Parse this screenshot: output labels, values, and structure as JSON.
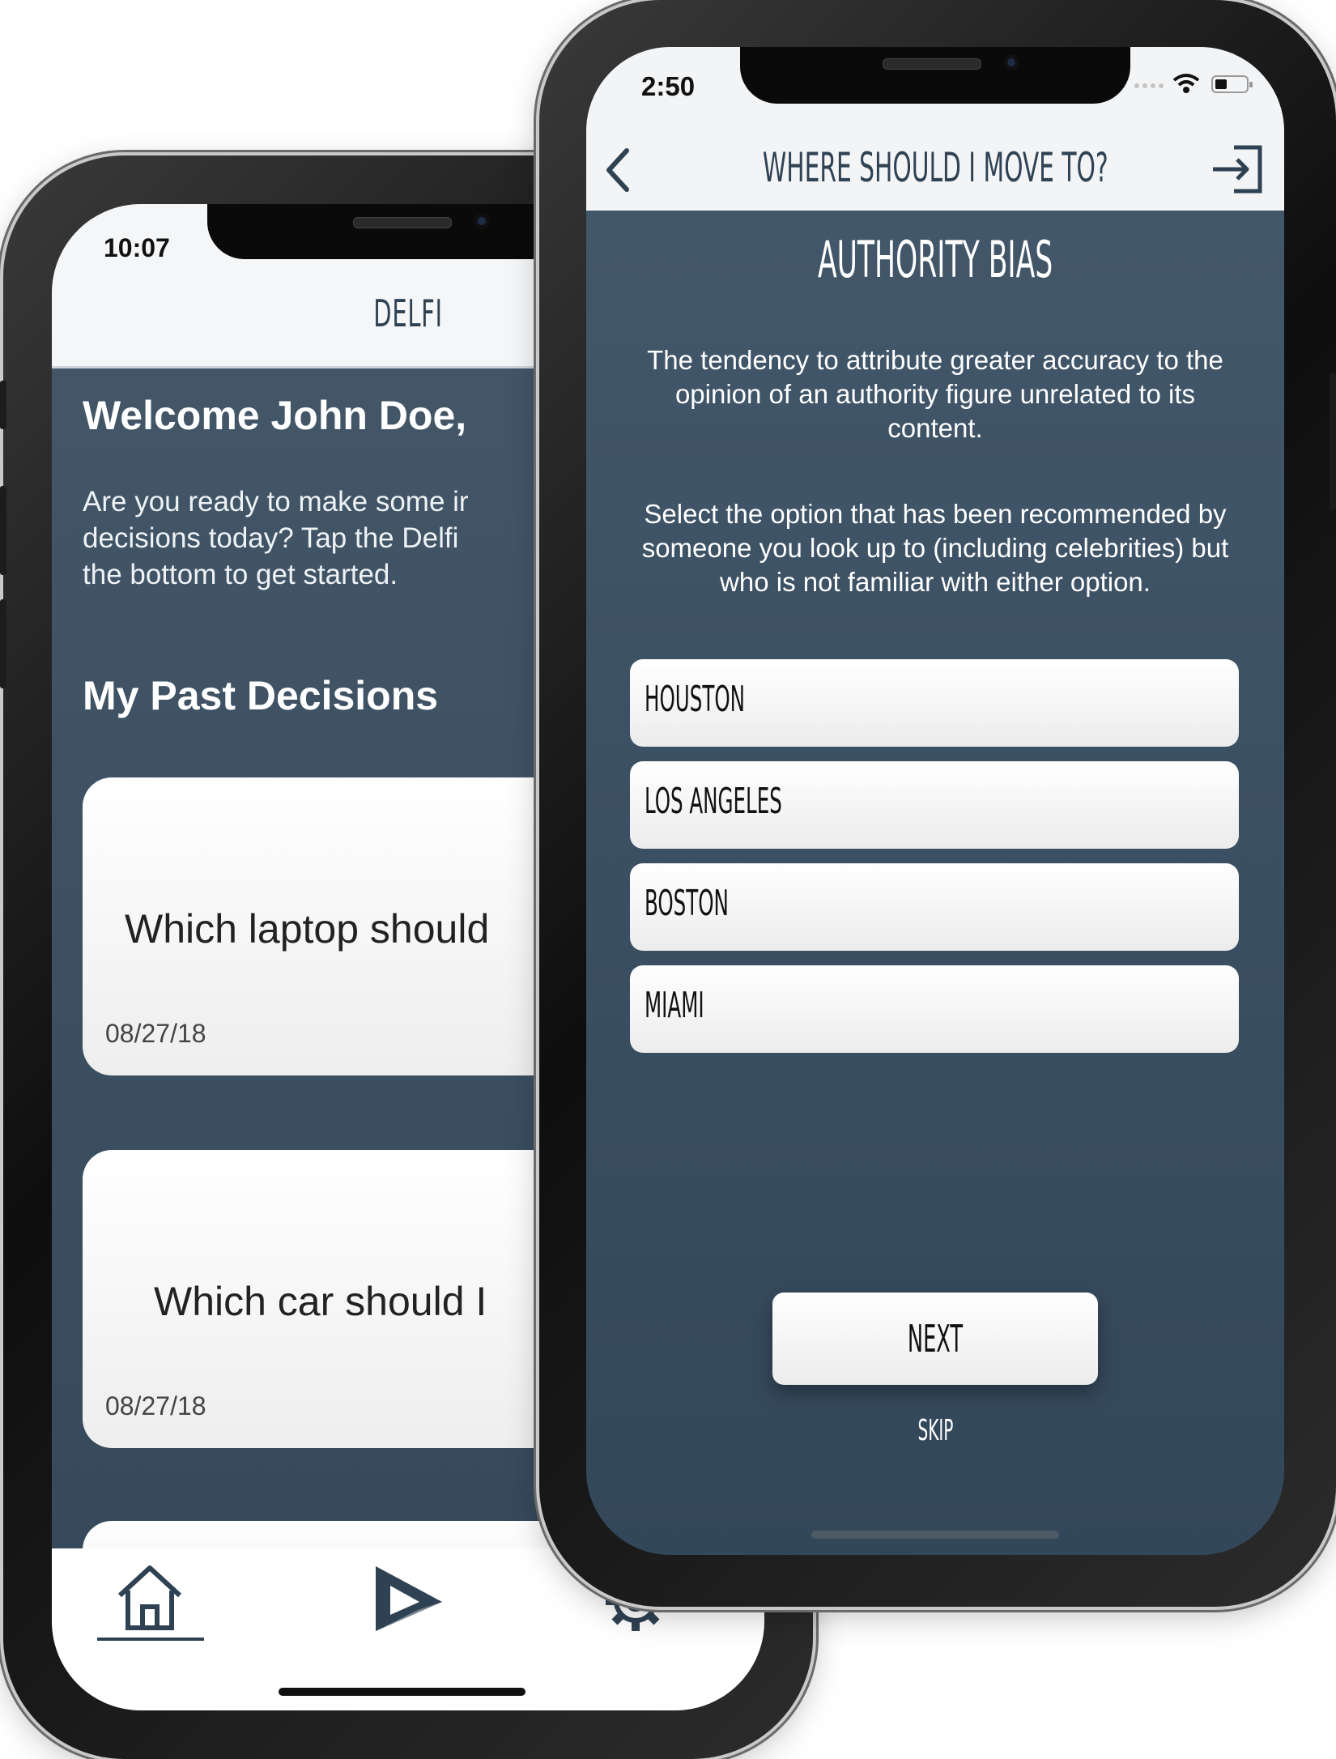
{
  "back_screen": {
    "status_time": "10:07",
    "app_title": "DELFI",
    "welcome": "Welcome John Doe,",
    "intro_lines": [
      "Are you ready to make some ir",
      "decisions today? Tap the Delfi",
      "the bottom to get started."
    ],
    "section_title": "My Past Decisions",
    "decisions": [
      {
        "question": "Which laptop should",
        "date": "08/27/18"
      },
      {
        "question": "Which car should I",
        "date": "08/27/18"
      }
    ],
    "tabbar": {
      "items": [
        {
          "icon": "home-icon",
          "active": true
        },
        {
          "icon": "play-icon",
          "active": false
        },
        {
          "icon": "gear-icon",
          "active": false
        }
      ]
    }
  },
  "front_screen": {
    "status_time": "2:50",
    "header": {
      "title": "WHERE SHOULD I MOVE TO?",
      "back_icon": "chevron-left-icon",
      "exit_icon": "sign-in-icon"
    },
    "bias_title": "AUTHORITY BIAS",
    "definition": "The tendency to attribute greater accuracy to the opinion of an authority figure unrelated to its content.",
    "instruction": "Select the option that has been recommended by someone you look up to (including celebrities) but who is not familiar with either option.",
    "options": [
      "HOUSTON",
      "LOS ANGELES",
      "BOSTON",
      "MIAMI"
    ],
    "next_label": "NEXT",
    "skip_label": "SKIP"
  },
  "colors": {
    "screen_bg": "#3b4f61",
    "header_text": "#2e4254",
    "card_bg": "#f4f4f4",
    "white": "#ffffff"
  }
}
